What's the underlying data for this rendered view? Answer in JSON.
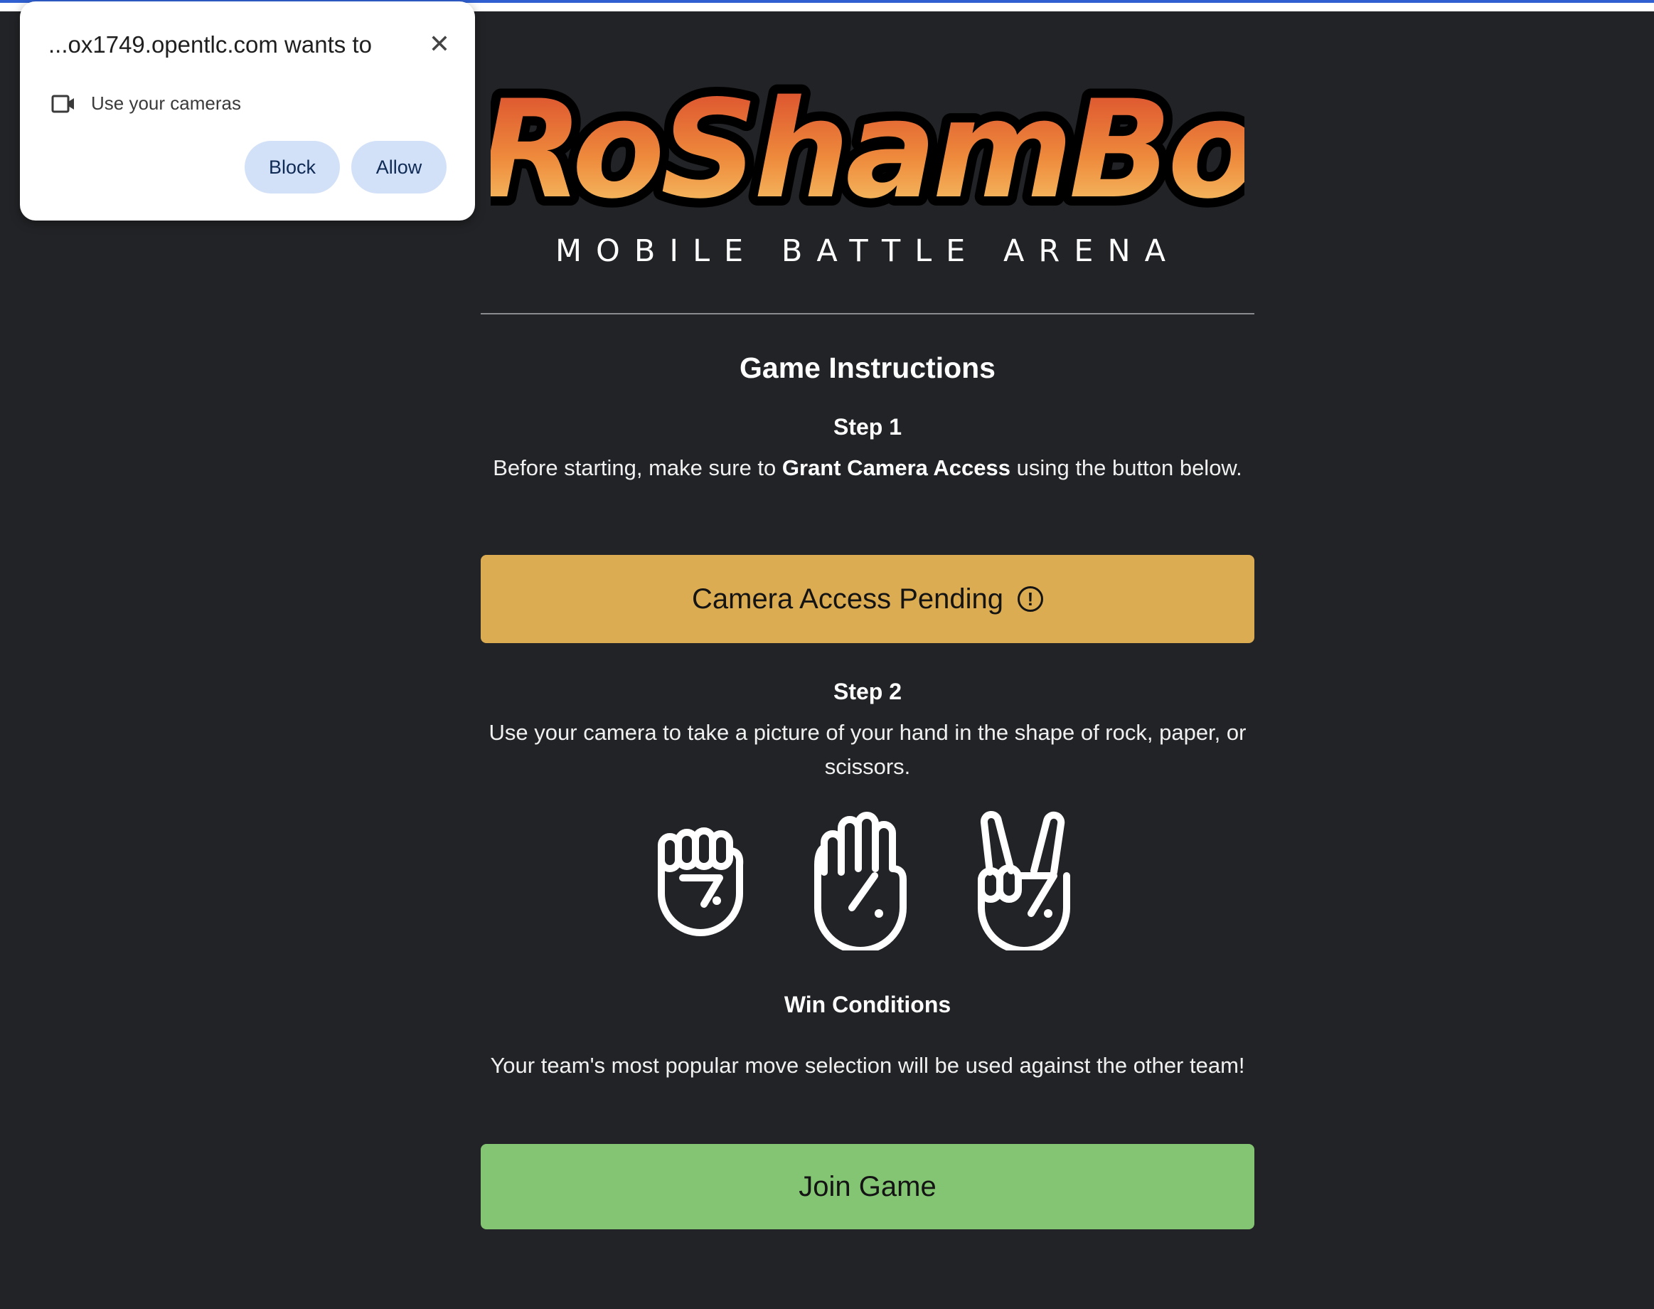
{
  "logo": {
    "wordmark": "RoShamBo",
    "subtitle": "MOBILE BATTLE ARENA"
  },
  "instructions": {
    "title": "Game Instructions",
    "step1": {
      "heading": "Step 1",
      "text_before": "Before starting, make sure to ",
      "text_bold": "Grant Camera Access",
      "text_after": " using the button below."
    },
    "camera_button": {
      "label": "Camera Access Pending",
      "icon": "exclamation-circle-icon",
      "color": "#dcac52"
    },
    "step2": {
      "heading": "Step 2",
      "text": "Use your camera to take a picture of your hand in the shape of rock, paper, or scissors."
    },
    "hands": [
      "rock-hand-icon",
      "paper-hand-icon",
      "scissors-hand-icon"
    ],
    "win": {
      "heading": "Win Conditions",
      "text": "Your team's most popular move selection will be used against the other team!"
    },
    "join_button": {
      "label": "Join Game",
      "color": "#83c572"
    }
  },
  "permission_popup": {
    "title": "...ox1749.opentlc.com wants to",
    "permission": "Use your cameras",
    "block_label": "Block",
    "allow_label": "Allow"
  },
  "colors": {
    "background": "#222326",
    "accent_bar": "#2f5fd0"
  }
}
